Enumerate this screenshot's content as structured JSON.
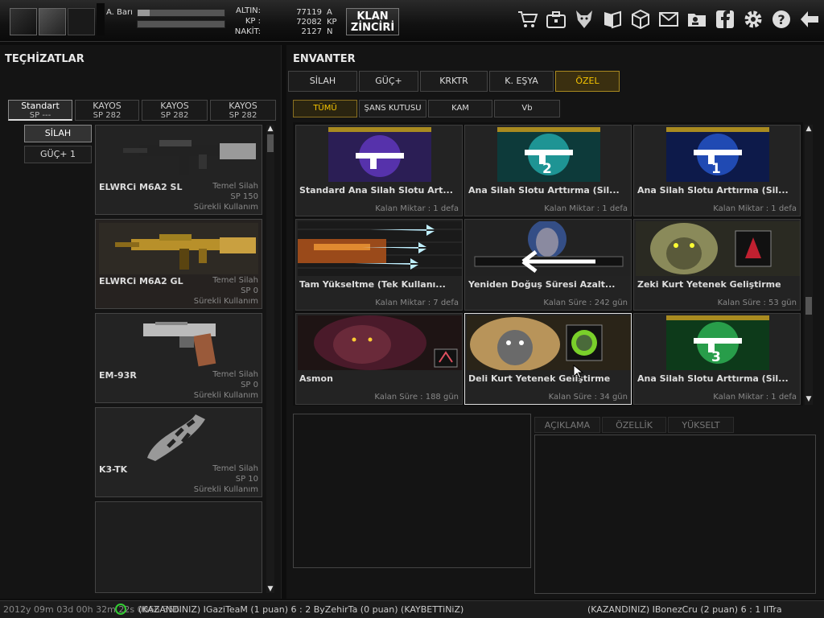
{
  "top": {
    "bar_label": "A. Barı",
    "currencies": [
      {
        "label": "ALTIN:",
        "value": "77119",
        "unit": "A"
      },
      {
        "label": "KP :",
        "value": "72082",
        "unit": "KP"
      },
      {
        "label": "NAKİT:",
        "value": "2127",
        "unit": "N"
      }
    ],
    "clan_button": {
      "line1": "KLAN",
      "line2": "ZİNCİRİ"
    },
    "icons": [
      "cart-icon",
      "bag-icon",
      "wolf-icon",
      "book-icon",
      "box-icon",
      "mail-icon",
      "profile-icon",
      "facebook-icon",
      "gear-icon",
      "help-icon",
      "back-arrow-icon"
    ]
  },
  "left": {
    "title": "TEÇHİZATLAR",
    "tabs": [
      {
        "label": "Standart",
        "sp": "SP ---"
      },
      {
        "label": "KAYOS",
        "sp": "SP 282"
      },
      {
        "label": "KAYOS",
        "sp": "SP 282"
      },
      {
        "label": "KAYOS",
        "sp": "SP 282"
      }
    ],
    "side_buttons": [
      "SİLAH",
      "GÜÇ+ 1"
    ],
    "items": [
      {
        "name": "ELWRCi M6A2 SL",
        "type": "Temel Silah",
        "sp": "SP 150",
        "use": "Sürekli Kullanım"
      },
      {
        "name": "ELWRCi M6A2 GL",
        "type": "Temel Silah",
        "sp": "SP 0",
        "use": "Sürekli Kullanım"
      },
      {
        "name": "EM-93R",
        "type": "Temel Silah",
        "sp": "SP 0",
        "use": "Sürekli Kullanım"
      },
      {
        "name": "K3-TK",
        "type": "Temel Silah",
        "sp": "SP 10",
        "use": "Sürekli Kullanım"
      }
    ]
  },
  "right": {
    "title": "ENVANTER",
    "tabs": [
      "SİLAH",
      "GÜÇ+",
      "KRKTR",
      "K. EŞYA",
      "ÖZEL"
    ],
    "subtabs": [
      "TÜMÜ",
      "ŞANS KUTUSU",
      "KAM",
      "Vb"
    ],
    "items": [
      {
        "name": "Standard Ana Silah Slotu Art...",
        "qty": "Kalan Miktar : 1 defa",
        "badge": ""
      },
      {
        "name": "Ana Silah Slotu Arttırma (Sil...",
        "qty": "Kalan Miktar : 1 defa",
        "badge": "2"
      },
      {
        "name": "Ana Silah Slotu Arttırma (Sil...",
        "qty": "Kalan Miktar : 1 defa",
        "badge": "1"
      },
      {
        "name": "Tam Yükseltme (Tek Kullanı...",
        "qty": "Kalan Miktar : 7 defa",
        "badge": ""
      },
      {
        "name": "Yeniden Doğuş Süresi Azalt...",
        "qty": "Kalan Süre : 242 gün",
        "badge": ""
      },
      {
        "name": "Zeki Kurt Yetenek Geliştirme",
        "qty": "Kalan Süre : 53 gün",
        "badge": ""
      },
      {
        "name": "Asmon",
        "qty": "Kalan Süre : 188 gün",
        "badge": ""
      },
      {
        "name": "Deli Kurt Yetenek Geliştirme",
        "qty": "Kalan Süre : 34 gün",
        "badge": ""
      },
      {
        "name": "Ana Silah Slotu Arttırma (Sil...",
        "qty": "Kalan Miktar : 1 defa",
        "badge": "3"
      }
    ],
    "detail_tabs": [
      "AÇIKLAMA",
      "ÖZELLİK",
      "YÜKSELT"
    ]
  },
  "ticker": {
    "left": "2012y 09m 03d 00h 32m 22s 0866 356",
    "middle": "(KAZANDINIZ) IGaziTeaM (1 puan) 6 : 2 ByZehirTa (0 puan) (KAYBETTiNiZ)",
    "right": "(KAZANDINIZ) IBonezCru (2 puan) 6 : 1 IITra"
  },
  "colors": {
    "accent": "#f5c400",
    "bg": "#141414"
  }
}
